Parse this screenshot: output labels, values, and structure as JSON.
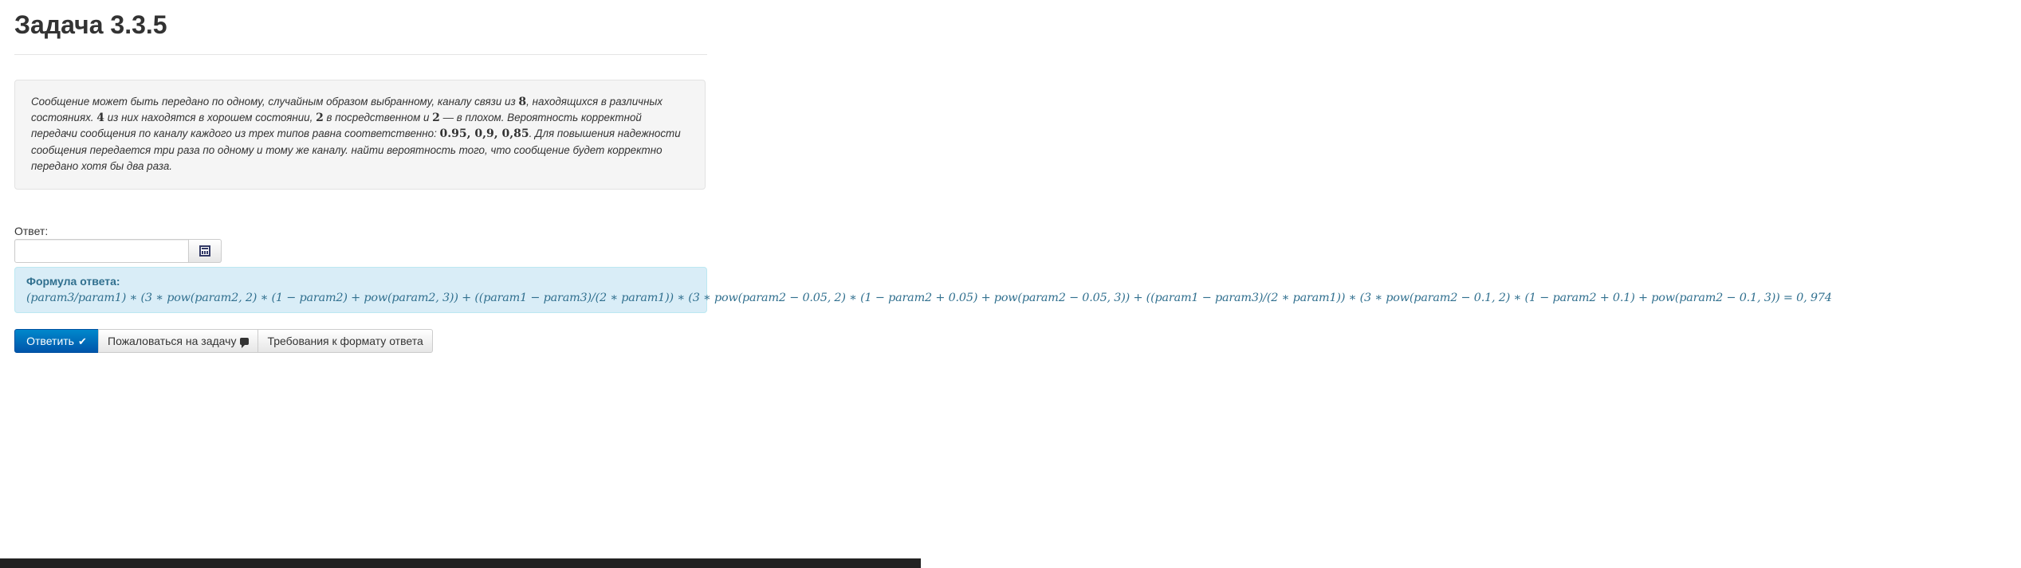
{
  "page": {
    "title": "Задача 3.3.5"
  },
  "problem": {
    "t1": "Сообщение может быть передано по одному, случайным образом выбранному, каналу связи из ",
    "n1": "8",
    "t2": ", находящихся в различных состояниях. ",
    "n2": "4",
    "t3": " из них находятся в хорошем состоянии, ",
    "n3": "2",
    "t4": " в посредственном и ",
    "n4": "2",
    "t5": " — в плохом. Вероятность корректной передачи сообщения по каналу каждого из трех типов равна соответственно: ",
    "n5": "0.95, 0,9, 0,85",
    "t6": ". Для повышения надежности сообщения передается три раза по одному и тому же каналу. найти вероятность того, что сообщение будет корректно передано хотя бы два раза."
  },
  "answer": {
    "label": "Ответ:",
    "value": "",
    "placeholder": ""
  },
  "formula": {
    "label": "Формула ответа:",
    "expression": "(param3/param1) ∗ (3 ∗ pow(param2, 2) ∗ (1 − param2) + pow(param2, 3)) + ((param1 − param3)/(2 ∗ param1)) ∗ (3 ∗ pow(param2 − 0.05, 2) ∗ (1 − param2 + 0.05) + pow(param2 − 0.05, 3)) + ((param1 − param3)/(2 ∗ param1)) ∗ (3 ∗ pow(param2 − 0.1, 2) ∗ (1 − param2 + 0.1) + pow(param2 − 0.1, 3)) = 0, 974"
  },
  "actions": {
    "submit_label": "Ответить",
    "complain_label": "Пожаловаться на задачу",
    "format_label": "Требования к формату ответа"
  },
  "colors": {
    "primary_button": "#0066cc",
    "formula_background": "#d9edf7",
    "formula_text": "#31708f",
    "problem_background": "#f5f5f5"
  },
  "icons": {
    "calculator": "calculator-icon",
    "submit": "check-icon",
    "complain": "comment-icon"
  }
}
